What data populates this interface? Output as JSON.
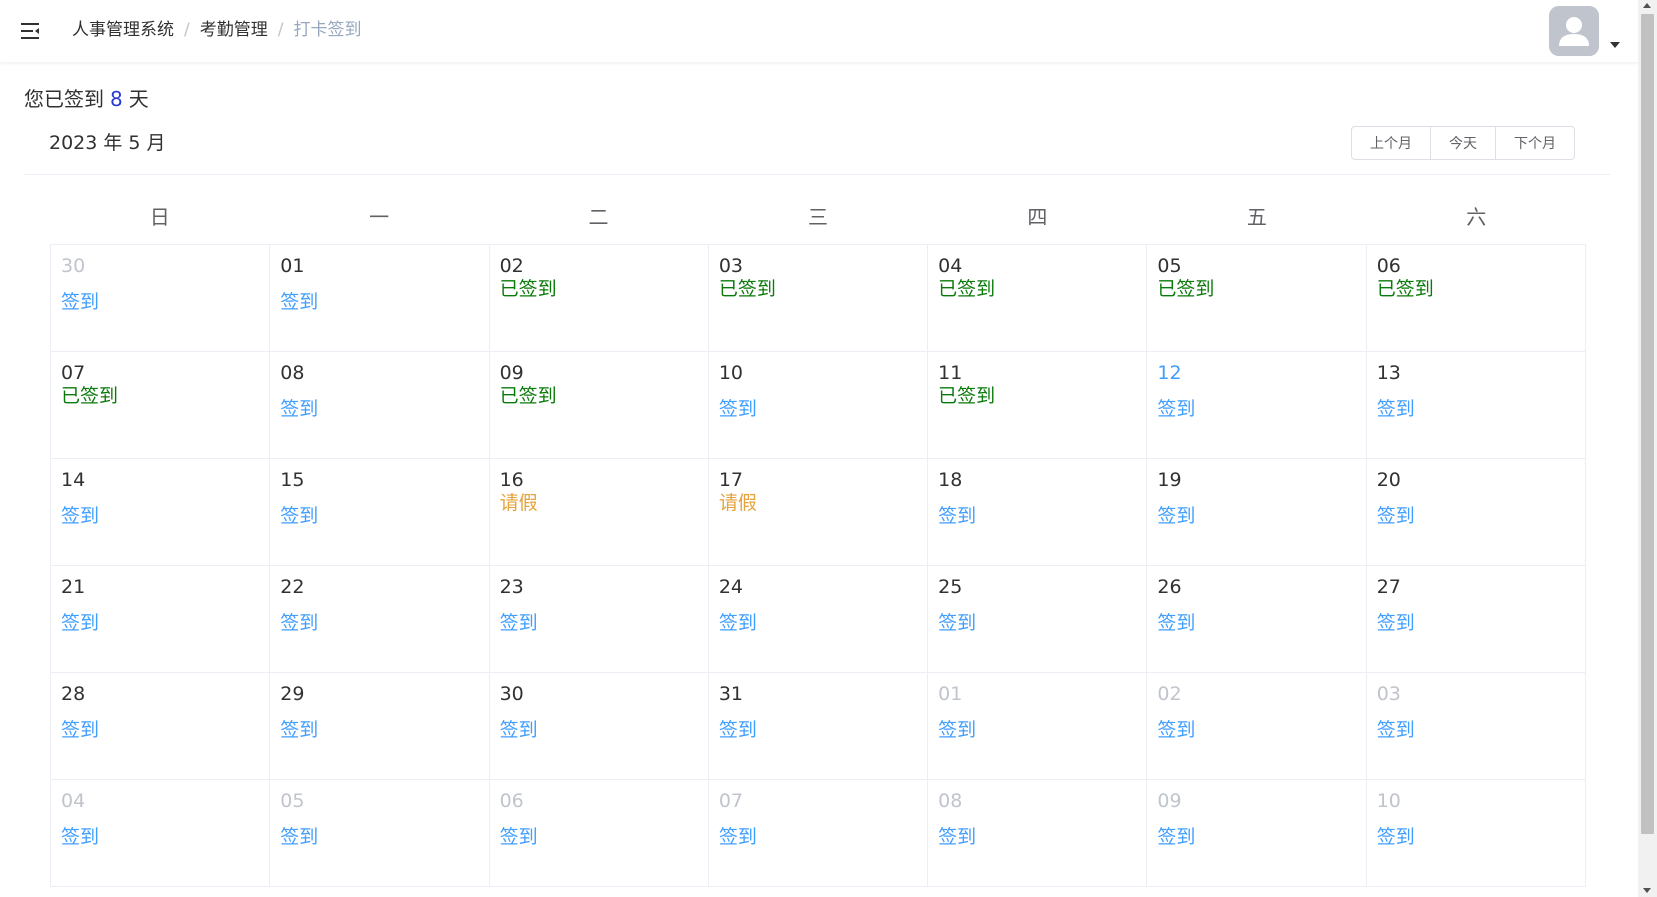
{
  "navbar": {
    "menu_icon": "hamburger-fold-icon",
    "breadcrumb": [
      "人事管理系统",
      "考勤管理",
      "打卡签到"
    ],
    "separator": "/",
    "avatar_icon": "user-avatar-icon"
  },
  "summary": {
    "prefix": "您已签到",
    "count": "8",
    "suffix": "天"
  },
  "calendar": {
    "title": "2023 年 5 月",
    "buttons": {
      "prev": "上个月",
      "today": "今天",
      "next": "下个月"
    },
    "weekdays": [
      "日",
      "一",
      "二",
      "三",
      "四",
      "五",
      "六"
    ],
    "weeks": [
      [
        {
          "day": "30",
          "status": "签到",
          "type": "signin",
          "month": "other"
        },
        {
          "day": "01",
          "status": "签到",
          "type": "signin",
          "month": "current"
        },
        {
          "day": "02",
          "status": "已签到",
          "type": "signed",
          "month": "current"
        },
        {
          "day": "03",
          "status": "已签到",
          "type": "signed",
          "month": "current"
        },
        {
          "day": "04",
          "status": "已签到",
          "type": "signed",
          "month": "current"
        },
        {
          "day": "05",
          "status": "已签到",
          "type": "signed",
          "month": "current"
        },
        {
          "day": "06",
          "status": "已签到",
          "type": "signed",
          "month": "current"
        }
      ],
      [
        {
          "day": "07",
          "status": "已签到",
          "type": "signed",
          "month": "current"
        },
        {
          "day": "08",
          "status": "签到",
          "type": "signin",
          "month": "current"
        },
        {
          "day": "09",
          "status": "已签到",
          "type": "signed",
          "month": "current"
        },
        {
          "day": "10",
          "status": "签到",
          "type": "signin",
          "month": "current"
        },
        {
          "day": "11",
          "status": "已签到",
          "type": "signed",
          "month": "current"
        },
        {
          "day": "12",
          "status": "签到",
          "type": "signin",
          "month": "today"
        },
        {
          "day": "13",
          "status": "签到",
          "type": "signin",
          "month": "current"
        }
      ],
      [
        {
          "day": "14",
          "status": "签到",
          "type": "signin",
          "month": "current"
        },
        {
          "day": "15",
          "status": "签到",
          "type": "signin",
          "month": "current"
        },
        {
          "day": "16",
          "status": "请假",
          "type": "leave",
          "month": "current"
        },
        {
          "day": "17",
          "status": "请假",
          "type": "leave",
          "month": "current"
        },
        {
          "day": "18",
          "status": "签到",
          "type": "signin",
          "month": "current"
        },
        {
          "day": "19",
          "status": "签到",
          "type": "signin",
          "month": "current"
        },
        {
          "day": "20",
          "status": "签到",
          "type": "signin",
          "month": "current"
        }
      ],
      [
        {
          "day": "21",
          "status": "签到",
          "type": "signin",
          "month": "current"
        },
        {
          "day": "22",
          "status": "签到",
          "type": "signin",
          "month": "current"
        },
        {
          "day": "23",
          "status": "签到",
          "type": "signin",
          "month": "current"
        },
        {
          "day": "24",
          "status": "签到",
          "type": "signin",
          "month": "current"
        },
        {
          "day": "25",
          "status": "签到",
          "type": "signin",
          "month": "current"
        },
        {
          "day": "26",
          "status": "签到",
          "type": "signin",
          "month": "current"
        },
        {
          "day": "27",
          "status": "签到",
          "type": "signin",
          "month": "current"
        }
      ],
      [
        {
          "day": "28",
          "status": "签到",
          "type": "signin",
          "month": "current"
        },
        {
          "day": "29",
          "status": "签到",
          "type": "signin",
          "month": "current"
        },
        {
          "day": "30",
          "status": "签到",
          "type": "signin",
          "month": "current"
        },
        {
          "day": "31",
          "status": "签到",
          "type": "signin",
          "month": "current"
        },
        {
          "day": "01",
          "status": "签到",
          "type": "signin",
          "month": "other"
        },
        {
          "day": "02",
          "status": "签到",
          "type": "signin",
          "month": "other"
        },
        {
          "day": "03",
          "status": "签到",
          "type": "signin",
          "month": "other"
        }
      ],
      [
        {
          "day": "04",
          "status": "签到",
          "type": "signin",
          "month": "other"
        },
        {
          "day": "05",
          "status": "签到",
          "type": "signin",
          "month": "other"
        },
        {
          "day": "06",
          "status": "签到",
          "type": "signin",
          "month": "other"
        },
        {
          "day": "07",
          "status": "签到",
          "type": "signin",
          "month": "other"
        },
        {
          "day": "08",
          "status": "签到",
          "type": "signin",
          "month": "other"
        },
        {
          "day": "09",
          "status": "签到",
          "type": "signin",
          "month": "other"
        },
        {
          "day": "10",
          "status": "签到",
          "type": "signin",
          "month": "other"
        }
      ]
    ]
  },
  "colors": {
    "signin": "#409eff",
    "signed": "#0a7a0a",
    "leave": "#e6a23c",
    "other_month": "#c0c4cc",
    "today": "#409eff"
  }
}
